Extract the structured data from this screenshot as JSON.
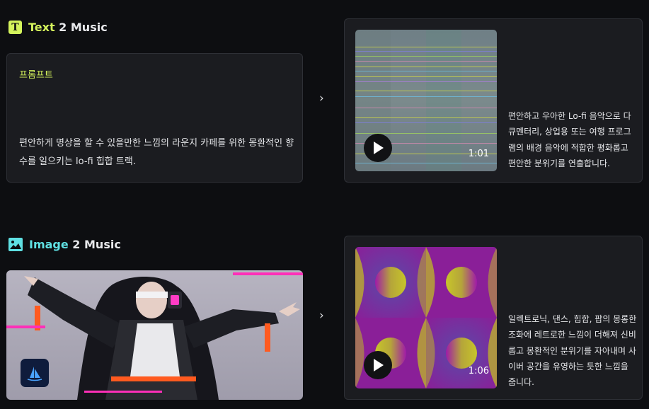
{
  "sections": {
    "text": {
      "title_highlight": "Text",
      "title_rest": " 2 Music",
      "icon": "t-letter-icon",
      "accent": "#d4f35c",
      "prompt_label": "프롬프트",
      "prompt_text": "편안하게 명상을 할 수 있을만한 느낌의 라운지 카페를 위한 몽환적인 향수를 일으키는 lo-fi 힙합 트랙.",
      "result": {
        "duration": "1:01",
        "description": "편안하고 우아한 Lo-fi 음악으로 다큐멘터리, 상업용 또는 여행 프로그램의 배경 음악에 적합한 평화롭고 편안한 분위기를 연출합니다."
      }
    },
    "image": {
      "title_highlight": "Image",
      "title_rest": " 2 Music",
      "icon": "image-icon",
      "accent": "#5fe0e3",
      "result": {
        "duration": "1:06",
        "description": "일렉트로닉, 댄스, 힙합, 팝의 몽롱한 조화에 레트로한 느낌이 더해져 신비롭고 몽환적인 분위기를 자아내며 사이버 공간을 유영하는 듯한 느낌을 줍니다."
      }
    }
  },
  "arrow_icon": "chevron-right-icon",
  "play_icon": "play-icon"
}
